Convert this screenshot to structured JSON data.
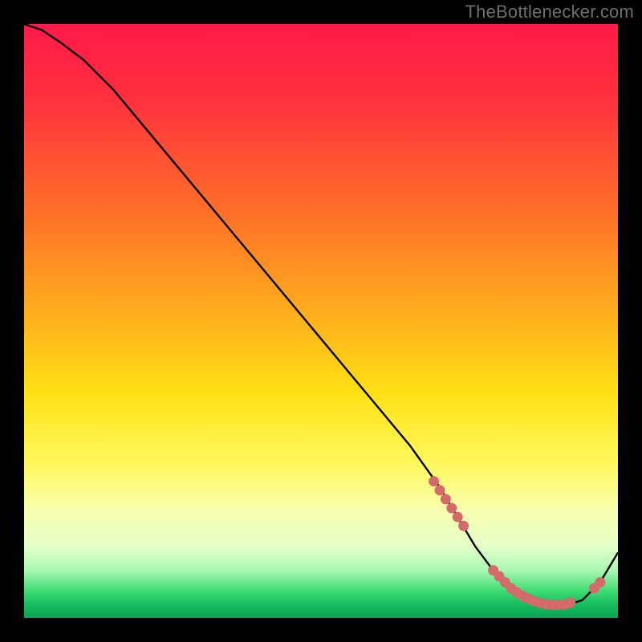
{
  "attribution": "TheBottlenecker.com",
  "chart_data": {
    "type": "line",
    "title": "",
    "xlabel": "",
    "ylabel": "",
    "xlim": [
      0,
      100
    ],
    "ylim": [
      0,
      100
    ],
    "grid": false,
    "legend": false,
    "series": [
      {
        "name": "bottleneck-curve",
        "x": [
          0,
          3,
          6,
          10,
          15,
          20,
          25,
          30,
          35,
          40,
          45,
          50,
          55,
          60,
          65,
          70,
          73,
          76,
          79,
          82,
          85,
          88,
          91,
          94,
          97,
          100
        ],
        "y": [
          100,
          99,
          97,
          94,
          89,
          83,
          77,
          71,
          65,
          59,
          53,
          47,
          41,
          35,
          29,
          22,
          17,
          12,
          8,
          5,
          3,
          2,
          2,
          3,
          6,
          11
        ]
      }
    ],
    "markers": [
      {
        "name": "highlight-dots",
        "color": "#d46a6a",
        "points": [
          {
            "x": 69,
            "y": 23
          },
          {
            "x": 70,
            "y": 21.5
          },
          {
            "x": 71,
            "y": 20
          },
          {
            "x": 72,
            "y": 18.5
          },
          {
            "x": 73,
            "y": 17
          },
          {
            "x": 74,
            "y": 15.5
          },
          {
            "x": 79,
            "y": 8
          },
          {
            "x": 80,
            "y": 7
          },
          {
            "x": 81,
            "y": 6
          },
          {
            "x": 82,
            "y": 5
          },
          {
            "x": 83,
            "y": 4.3
          },
          {
            "x": 84,
            "y": 3.7
          },
          {
            "x": 85,
            "y": 3.2
          },
          {
            "x": 86,
            "y": 2.8
          },
          {
            "x": 87,
            "y": 2.5
          },
          {
            "x": 88,
            "y": 2.3
          },
          {
            "x": 89,
            "y": 2.2
          },
          {
            "x": 90,
            "y": 2.2
          },
          {
            "x": 91,
            "y": 2.3
          },
          {
            "x": 92,
            "y": 2.6
          },
          {
            "x": 96,
            "y": 5
          },
          {
            "x": 97,
            "y": 6
          }
        ]
      }
    ],
    "background_gradient_stops": [
      {
        "offset": 0.0,
        "color": "#ff1a49"
      },
      {
        "offset": 0.12,
        "color": "#ff2f3f"
      },
      {
        "offset": 0.3,
        "color": "#ff6a2a"
      },
      {
        "offset": 0.48,
        "color": "#ffab1e"
      },
      {
        "offset": 0.62,
        "color": "#ffe014"
      },
      {
        "offset": 0.74,
        "color": "#fff85e"
      },
      {
        "offset": 0.82,
        "color": "#f8ffb0"
      },
      {
        "offset": 0.88,
        "color": "#e4ffc8"
      },
      {
        "offset": 0.92,
        "color": "#a8f7b0"
      },
      {
        "offset": 0.955,
        "color": "#3edc74"
      },
      {
        "offset": 0.975,
        "color": "#18c060"
      },
      {
        "offset": 1.0,
        "color": "#0aa452"
      }
    ]
  }
}
